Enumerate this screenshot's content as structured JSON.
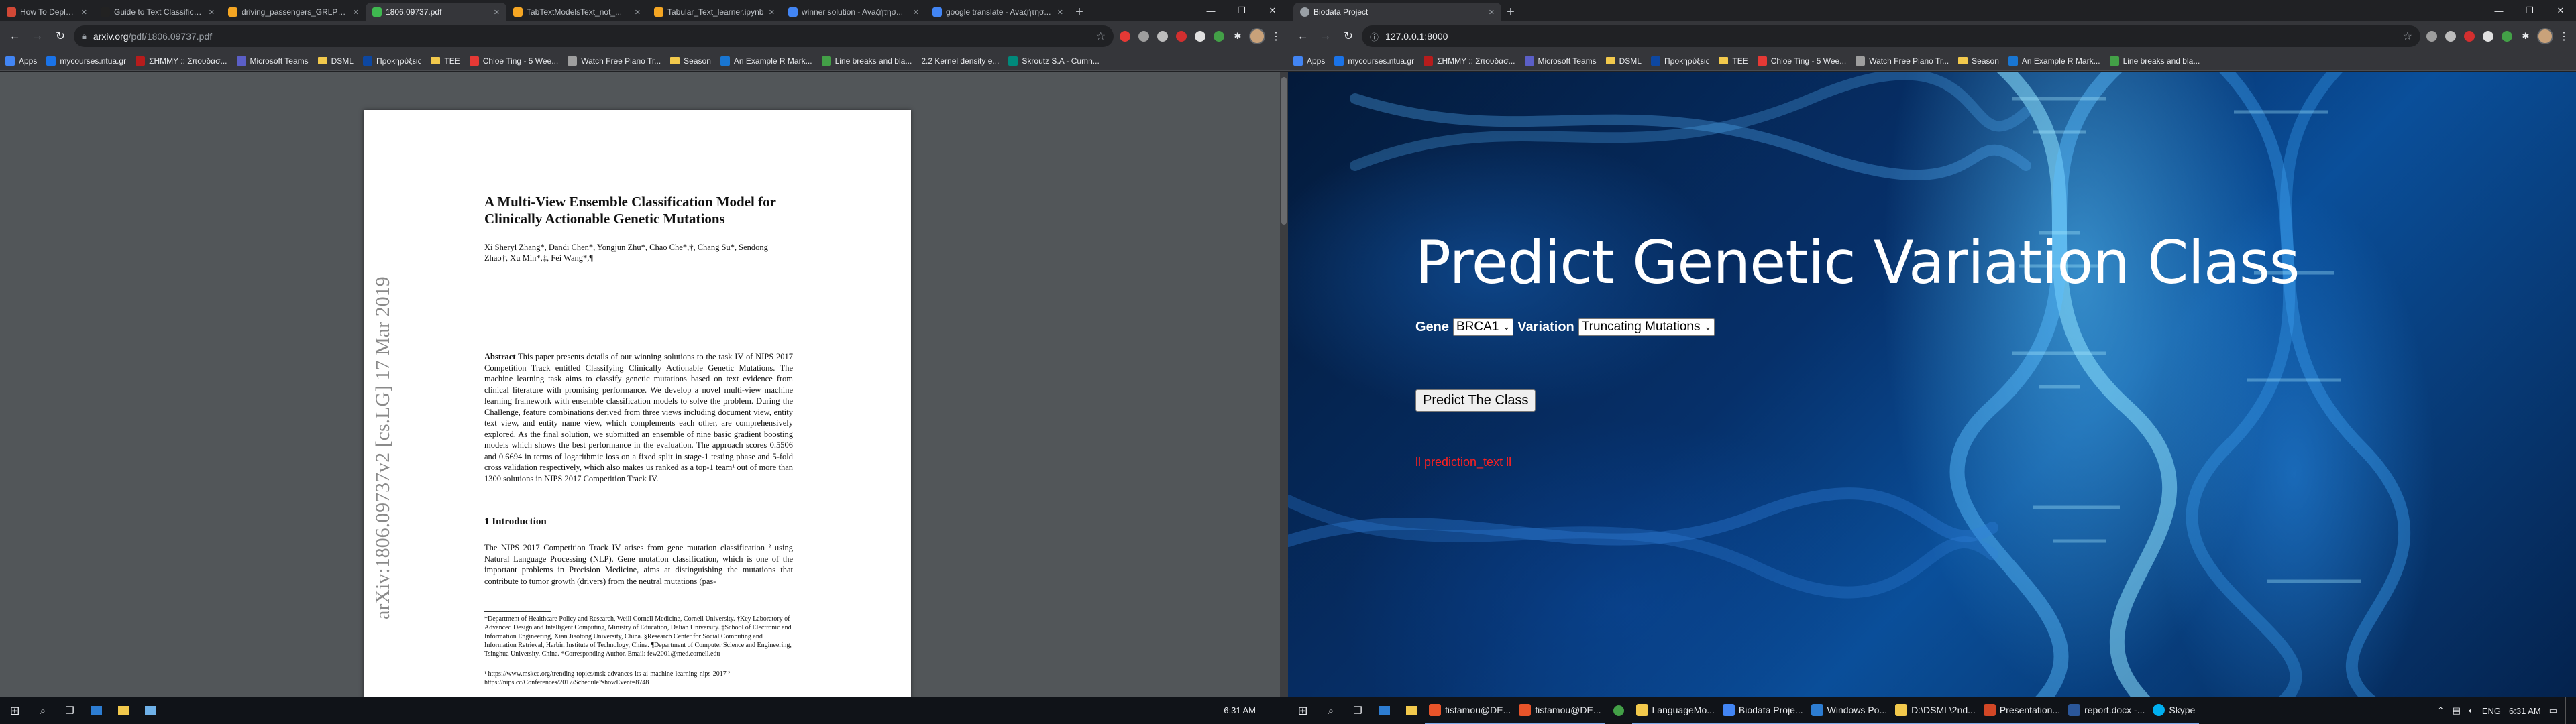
{
  "left": {
    "tabs": [
      {
        "title": "How To Deploy A Fasta M...",
        "favicon_color": "#d14836"
      },
      {
        "title": "Guide to Text Classification...",
        "favicon_color": "#222222"
      },
      {
        "title": "driving_passengers_GRLPH...",
        "favicon_color": "#f5a623"
      },
      {
        "title": "1806.09737.pdf",
        "favicon_color": "#3fb950",
        "active": true
      },
      {
        "title": "TabTextModelsText_not_...",
        "favicon_color": "#f5a623"
      },
      {
        "title": "Tabular_Text_learner.ipynb",
        "favicon_color": "#f5a623"
      },
      {
        "title": "winner solution - Avaζήτησ...",
        "favicon_color": "#4285f4"
      },
      {
        "title": "google translate - Avaζήτησ...",
        "favicon_color": "#4285f4"
      }
    ],
    "url_host": "arxiv.org",
    "url_path": "/pdf/1806.09737.pdf",
    "bookmarks": [
      "Apps",
      "mycourses.ntua.gr",
      "ΣΗΜΜΥ :: Σπουδασ...",
      "Microsoft Teams",
      "DSML",
      "Προκηρύξεις",
      "TEE",
      "Chloe Ting - 5 Wee...",
      "Watch Free Piano Tr...",
      "Season",
      "An Example R Mark...",
      "Line breaks and bla...",
      "2.2 Kernel density e...",
      "Skroutz S.A - Cumn..."
    ],
    "paper": {
      "arxiv_stamp": "arXiv:1806.09737v2  [cs.LG]  17 Mar 2019",
      "title": "A Multi-View Ensemble Classification Model for Clinically Actionable Genetic Mutations",
      "authors": "Xi Sheryl Zhang*, Dandi Chen*, Yongjun Zhu*, Chao Che*,†, Chang Su*, Sendong Zhao†, Xu Min*,‡, Fei Wang*,¶",
      "abstract_label": "Abstract",
      "abstract": "This paper presents details of our winning solutions to the task IV of NIPS 2017 Competition Track entitled Classifying Clinically Actionable Genetic Mutations. The machine learning task aims to classify genetic mutations based on text evidence from clinical literature with promising performance. We develop a novel multi-view machine learning framework with ensemble classification models to solve the problem. During the Challenge, feature combinations derived from three views including document view, entity text view, and entity name view, which complements each other, are comprehensively explored. As the final solution, we submitted an ensemble of nine basic gradient boosting models which shows the best performance in the evaluation. The approach scores 0.5506 and 0.6694 in terms of logarithmic loss on a fixed split in stage-1 testing phase and 5-fold cross validation respectively, which also makes us ranked as a top-1 team¹ out of more than 1300 solutions in NIPS 2017 Competition Track IV.",
      "section_heading": "1  Introduction",
      "intro": "The NIPS 2017 Competition Track IV arises from gene mutation classification ² using Natural Language Processing (NLP). Gene mutation classification, which is one of the important problems in Precision Medicine, aims at distinguishing the mutations that contribute to tumor growth (drivers) from the neutral mutations (pas-",
      "footnotes": "*Department of Healthcare Policy and Research, Weill Cornell Medicine, Cornell University. †Key Laboratory of Advanced Design and Intelligent Computing, Ministry of Education, Dalian University. ‡School of Electronic and Information Engineering, Xian Jiaotong University, China. §Research Center for Social Computing and Information Retrieval, Harbin Institute of Technology, China. ¶Department of Computer Science and Engineering, Tsinghua University, China. *Corresponding Author. Email: few2001@med.cornell.edu",
      "footnote_links": "¹ https://www.mskcc.org/trending-topics/msk-advances-its-ai-machine-learning-nips-2017   ² https://nips.cc/Conferences/2017/Schedule?showEvent=8748"
    },
    "taskbar_time": "6:31 AM"
  },
  "right": {
    "tab_title": "Biodata Project",
    "url": "127.0.0.1:8000",
    "bookmarks": [
      "Apps",
      "mycourses.ntua.gr",
      "ΣΗΜΜΥ :: Σπουδασ...",
      "Microsoft Teams",
      "DSML",
      "Προκηρύξεις",
      "TEE",
      "Chloe Ting - 5 Wee...",
      "Watch Free Piano Tr...",
      "Season",
      "An Example R Mark...",
      "Line breaks and bla..."
    ],
    "page": {
      "title": "Predict Genetic Variation Class",
      "gene_label": "Gene",
      "gene_value": "BRCA1",
      "variation_label": "Variation",
      "variation_value": "Truncating Mutations",
      "predict_button": "Predict The Class",
      "prediction_text": "ll prediction_text ll"
    },
    "taskbar_apps": [
      {
        "label": "fistamou@DE...",
        "color": "#e8542a"
      },
      {
        "label": "fistamou@DE...",
        "color": "#e8542a"
      },
      {
        "label": "LanguageMo...",
        "color": "#f2c94c"
      },
      {
        "label": "Biodata Proje...",
        "color": "#4285f4"
      },
      {
        "label": "Windows Po...",
        "color": "#2d7dd2"
      },
      {
        "label": "D:\\DSML\\2nd...",
        "color": "#f2c94c"
      },
      {
        "label": "Presentation...",
        "color": "#d24726"
      },
      {
        "label": "report.docx -...",
        "color": "#2b579a"
      },
      {
        "label": "Skype",
        "color": "#00aff0"
      }
    ],
    "tray_lang": "ENG",
    "taskbar_time": "6:31 AM"
  },
  "colors": {
    "chrome_dark": "#202124",
    "chrome_toolbar": "#35363a",
    "pdf_bg": "#525659",
    "prediction_red": "#ff2020"
  }
}
